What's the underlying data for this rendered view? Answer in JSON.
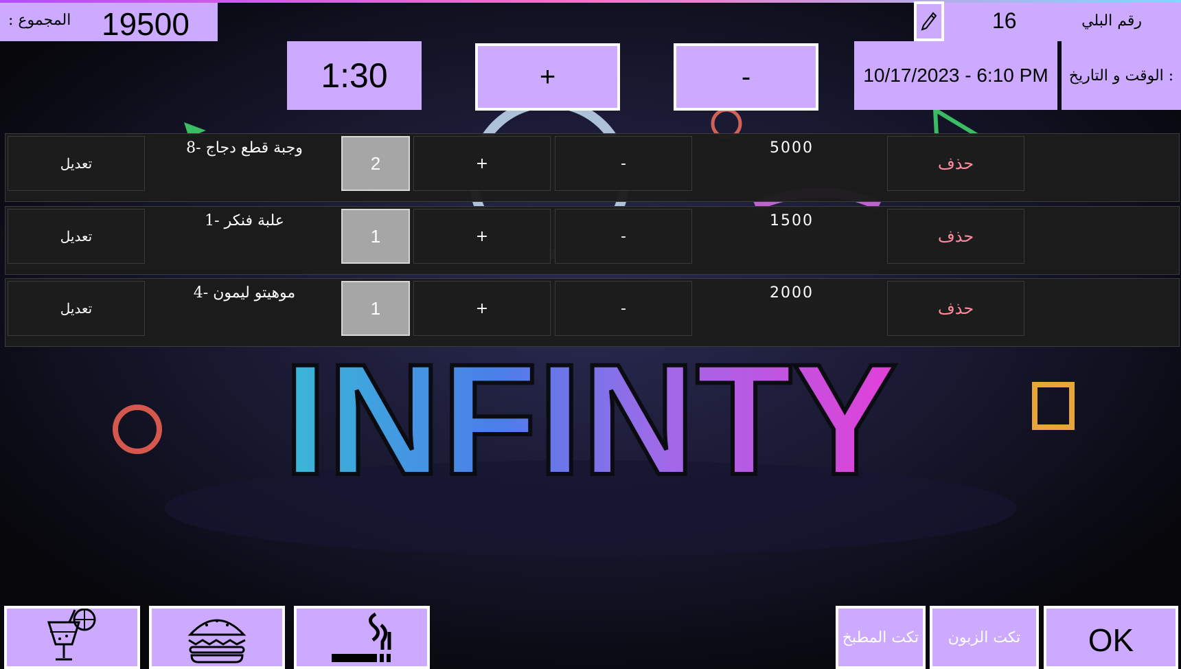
{
  "header": {
    "total_label": ": المجموع",
    "total_value": "19500",
    "table_label": "رقم البلي",
    "table_number": "16",
    "datetime_label": "الوقت و التاريخ :",
    "datetime_value": "10/17/2023 - 6:10 PM",
    "timer": "1:30",
    "plus": "+",
    "minus": "-"
  },
  "icons": {
    "edit_table": "pencil-icon",
    "drinks": "cocktail-icon",
    "food": "burger-icon",
    "smoking": "cigarette-icon"
  },
  "orders": [
    {
      "edit": "تعديل",
      "name": "وجبة قطع دجاج -8",
      "qty": "2",
      "plus": "+",
      "minus": "-",
      "price": "5000",
      "delete": "حذف"
    },
    {
      "edit": "تعديل",
      "name": "علبة فنكر -1",
      "qty": "1",
      "plus": "+",
      "minus": "-",
      "price": "1500",
      "delete": "حذف"
    },
    {
      "edit": "تعديل",
      "name": "موهيتو ليمون -4",
      "qty": "1",
      "plus": "+",
      "minus": "-",
      "price": "2000",
      "delete": "حذف"
    }
  ],
  "footer": {
    "kitchen_ticket": "تكت المطبخ",
    "customer_ticket": "تكت الزبون",
    "ok": "OK"
  },
  "background": {
    "logo_text": "INFINTY"
  },
  "colors": {
    "accent": "#cbaaff",
    "delete_text": "#ff8aa0",
    "row_bg": "#1c1c1c",
    "qty_bg": "#a6a6a6"
  }
}
